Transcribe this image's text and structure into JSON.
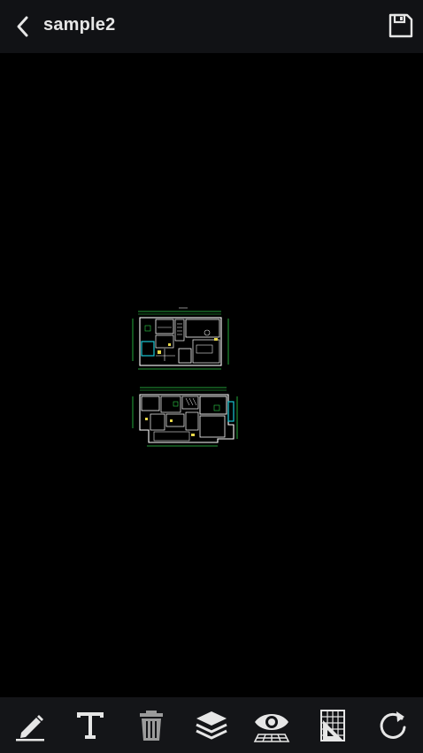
{
  "header": {
    "title": "sample2",
    "back_icon": "chevron-left-icon",
    "save_icon": "floppy-disk-icon"
  },
  "toolbar": {
    "tools": [
      {
        "id": "markup",
        "icon": "pencil-icon"
      },
      {
        "id": "text",
        "icon": "text-icon"
      },
      {
        "id": "delete",
        "icon": "trash-icon"
      },
      {
        "id": "layers",
        "icon": "layers-icon"
      },
      {
        "id": "view",
        "icon": "eye-icon"
      },
      {
        "id": "measure",
        "icon": "ruler-icon"
      },
      {
        "id": "rotate",
        "icon": "rotate-icon"
      }
    ]
  },
  "colors": {
    "header_bg": "#111215",
    "canvas_bg": "#000000",
    "toolbar_bg": "#141518",
    "icon": "#e6e6e6",
    "cad_white": "#ffffff",
    "cad_cyan": "#19c8d6",
    "cad_green": "#2fd24a",
    "cad_yellow": "#e8d84a"
  }
}
